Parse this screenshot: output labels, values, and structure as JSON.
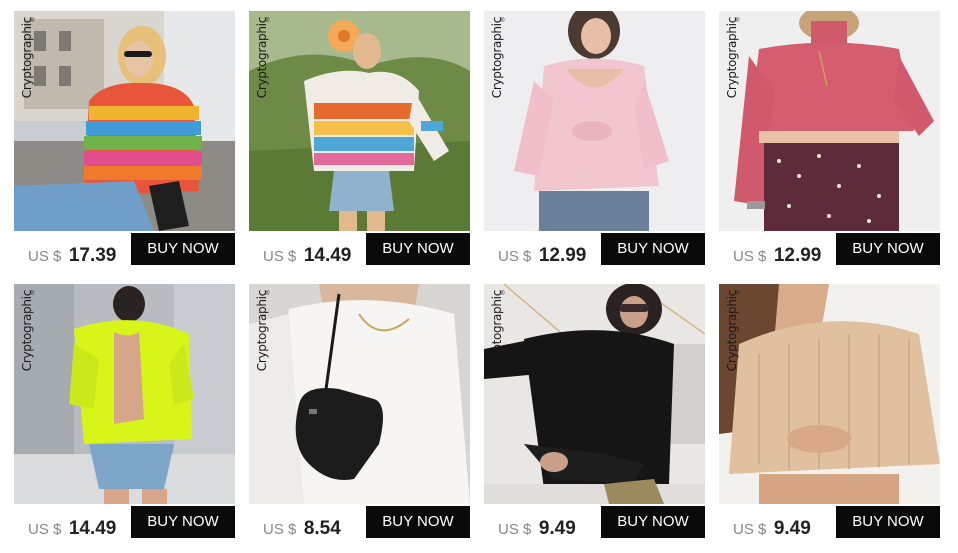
{
  "brand": "Cryptographic",
  "brand_mark": "®",
  "products": [
    {
      "currency": "US $",
      "price": "17.39",
      "button": "BUY NOW",
      "sweater": "rainbow-striped-sweater"
    },
    {
      "currency": "US $",
      "price": "14.49",
      "button": "BUY NOW",
      "sweater": "striped-distressed-sweater"
    },
    {
      "currency": "US $",
      "price": "12.99",
      "button": "BUY NOW",
      "sweater": "pink-off-shoulder-sweater"
    },
    {
      "currency": "US $",
      "price": "12.99",
      "button": "BUY NOW",
      "sweater": "pink-cropped-turtleneck"
    },
    {
      "currency": "US $",
      "price": "14.49",
      "button": "BUY NOW",
      "sweater": "neon-backless-sweater"
    },
    {
      "currency": "US $",
      "price": "8.54",
      "button": "BUY NOW",
      "sweater": "white-ribbed-top"
    },
    {
      "currency": "US $",
      "price": "9.49",
      "button": "BUY NOW",
      "sweater": "black-turtleneck"
    },
    {
      "currency": "US $",
      "price": "9.49",
      "button": "BUY NOW",
      "sweater": "beige-off-shoulder-sweater"
    }
  ],
  "colors": {
    "button_bg": "#0a0a0a",
    "button_text": "#ffffff",
    "currency_text": "#888888",
    "price_text": "#222222"
  }
}
